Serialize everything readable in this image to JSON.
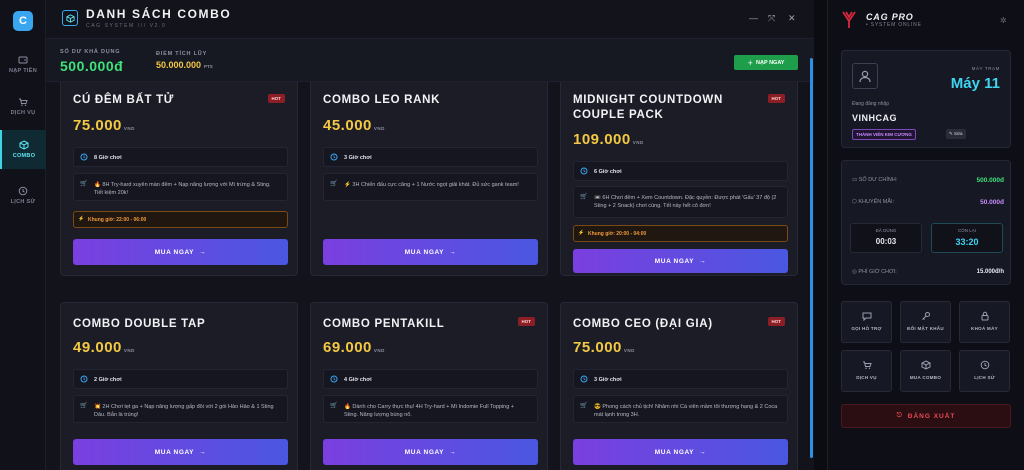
{
  "rail": {
    "logo": "C",
    "items": [
      {
        "label": "NẠP TIỀN",
        "icon": "wallet-icon"
      },
      {
        "label": "DỊCH VỤ",
        "icon": "cart-icon"
      },
      {
        "label": "COMBO",
        "icon": "box-icon"
      },
      {
        "label": "LỊCH SỬ",
        "icon": "clock-icon"
      }
    ]
  },
  "header": {
    "title": "DANH SÁCH COMBO",
    "subtitle": "CAG SYSTEM /// V2.0"
  },
  "balance": {
    "main_label": "SỐ DƯ KHẢ DỤNG",
    "main_value": "500.000đ",
    "points_label": "ĐIỂM TÍCH LŨY",
    "points_value": "50.000.000",
    "points_unit": "PTS",
    "topup_label": "NẠP NGAY"
  },
  "combos": [
    {
      "name": "CÚ ĐÊM BẤT TỬ",
      "hot": "HOT",
      "price": "75.000",
      "unit": "VND",
      "hours": "8 Giờ chơi",
      "emoji": "🔥",
      "desc": "8H Try-hard xuyên màn đêm + Nạp năng lượng với Mì trứng & Sting. Tiết kiệm 20k!",
      "slot": "Khung giờ: 22:00 - 06:00",
      "buy": "MUA NGAY"
    },
    {
      "name": "COMBO LEO RANK",
      "hot": "",
      "price": "45.000",
      "unit": "VND",
      "hours": "3 Giờ chơi",
      "emoji": "⚡",
      "desc": "3H Chiến đấu cực căng + 1 Nước ngọt giải khát. Đủ sức gank team!",
      "slot": "",
      "buy": "MUA NGAY"
    },
    {
      "name": "MIDNIGHT COUNTDOWN COUPLE PACK",
      "hot": "HOT",
      "price": "109.000",
      "unit": "VND",
      "hours": "6 Giờ chơi",
      "emoji": "📼",
      "desc": "6H Chơi đêm + Xem Countdown. Đặc quyền: Được phát 'Gấu' 37 độ (2 Sting + 2 Snack) chơi cùng. Tết này hết cô đơn!",
      "slot": "Khung giờ: 20:00 - 04:00",
      "buy": "MUA NGAY"
    },
    {
      "name": "COMBO DOUBLE TAP",
      "hot": "",
      "price": "49.000",
      "unit": "VND",
      "hours": "2 Giờ chơi",
      "emoji": "💥",
      "desc": "2H Chơi tẹt ga + Nạp năng lượng gấp đôi với 2 gói Hảo Hảo & 1 Sting Dâu. Bắn là trúng!",
      "slot": "",
      "buy": "MUA NGAY"
    },
    {
      "name": "COMBO PENTAKILL",
      "hot": "HOT",
      "price": "69.000",
      "unit": "VND",
      "hours": "4 Giờ chơi",
      "emoji": "🔥",
      "desc": "Dành cho Carry thực thụ! 4H Try-hard + Mì Indomie Full Topping + Sting. Năng lượng bùng nổ.",
      "slot": "",
      "buy": "MUA NGAY"
    },
    {
      "name": "COMBO CEO (ĐẠI GIA)",
      "hot": "HOT",
      "price": "75.000",
      "unit": "VND",
      "hours": "3 Giờ chơi",
      "emoji": "😎",
      "desc": "Phong cách chủ tịch! Nhâm nhi Cà viên mầm tôi thượng hạng & 2 Coca mát lạnh trong 3H.",
      "slot": "",
      "buy": "MUA NGAY"
    }
  ],
  "side": {
    "brand": "CAG PRO",
    "brand_sub": "• SYSTEM ONLINE",
    "machine_label": "MÁY TRẠM",
    "machine": "Máy 11",
    "login_label": "Đang đăng nhập",
    "username": "VINHCAG",
    "tier": "THÀNH VIÊN KIM CƯƠNG",
    "edit": "Sửa",
    "main_bal_label": "SỐ DƯ CHÍNH:",
    "main_bal": "500.000đ",
    "promo_label": "KHUYẾN MÃI:",
    "promo": "50.000đ",
    "used_label": "ĐÃ DÙNG",
    "used": "00:03",
    "left_label": "CÒN LẠI",
    "left": "33:20",
    "rate_label": "PHÍ GIỜ CHƠI:",
    "rate": "15.000đ/h",
    "actions": [
      {
        "label": "GỌI HỖ TRỢ",
        "icon": "chat-icon"
      },
      {
        "label": "ĐỔI MẬT KHẨU",
        "icon": "key-icon"
      },
      {
        "label": "KHOÁ MÁY",
        "icon": "lock-icon"
      },
      {
        "label": "DỊCH VỤ",
        "icon": "cart-icon"
      },
      {
        "label": "MUA COMBO",
        "icon": "box-icon"
      },
      {
        "label": "LỊCH SỬ",
        "icon": "clock-icon"
      }
    ],
    "logout": "ĐĂNG XUẤT"
  },
  "colors": {
    "accent": "#3ed6e6",
    "gold": "#f3c842",
    "green": "#3ee27a",
    "buy_gradient_start": "#7b3fe0",
    "buy_gradient_end": "#4a57e0",
    "danger": "#e84a56"
  }
}
